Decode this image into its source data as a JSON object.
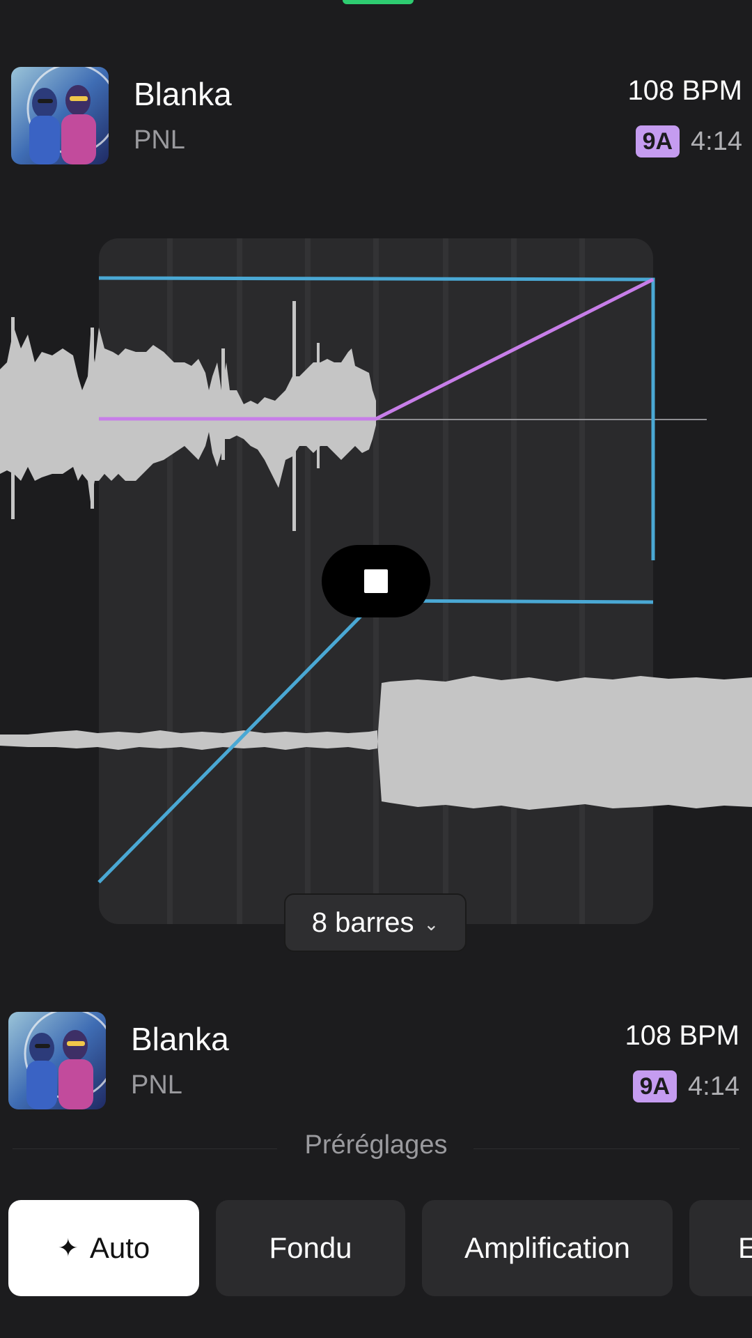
{
  "track_top": {
    "title": "Blanka",
    "artist": "PNL",
    "bpm": "108 BPM",
    "key": "9A",
    "duration": "4:14"
  },
  "mix": {
    "bars_label": "8 barres",
    "stop_icon": "stop-icon",
    "fade_color": "#c77ee8",
    "volume_color": "#4aa8d4"
  },
  "track_bottom": {
    "title": "Blanka",
    "artist": "PNL",
    "bpm": "108 BPM",
    "key": "9A",
    "duration": "4:14"
  },
  "presets": {
    "heading": "Préréglages",
    "items": [
      {
        "label": "Auto",
        "icon": "sparkle-icon",
        "active": true
      },
      {
        "label": "Fondu",
        "active": false
      },
      {
        "label": "Amplification",
        "active": false
      },
      {
        "label": "E",
        "active": false
      }
    ]
  },
  "colors": {
    "background": "#1c1c1e",
    "key_badge": "#c59cf0"
  }
}
